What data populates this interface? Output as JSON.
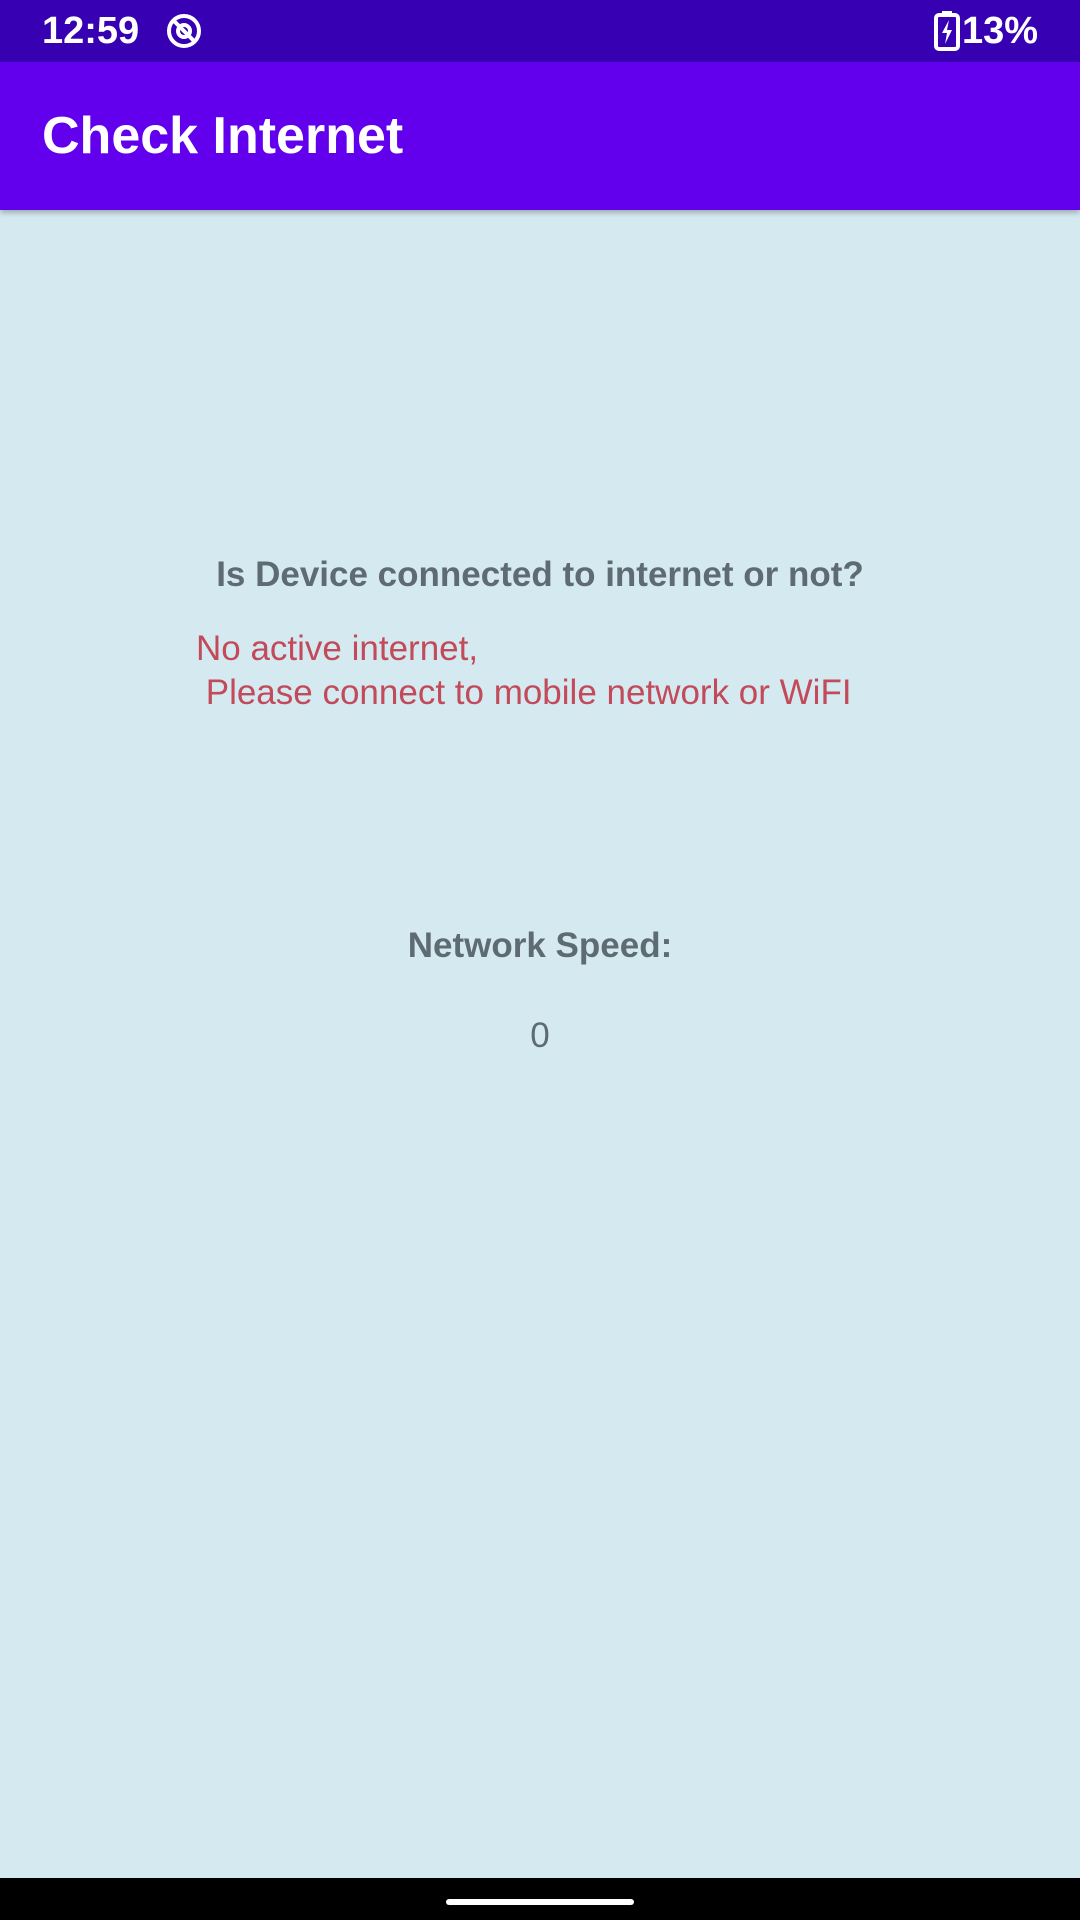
{
  "status_bar": {
    "time": "12:59",
    "battery_percent": "13%",
    "background_color": "#3700b3",
    "app_icon": "at-sign-icon",
    "battery_icon": "battery-charging-icon"
  },
  "app_bar": {
    "title": "Check Internet",
    "background_color": "#6200ee"
  },
  "main": {
    "question": "Is Device connected to internet or not?",
    "status_message": "No active internet,\n Please connect to mobile network or WiFI",
    "status_color": "#c24a5a",
    "speed_label": "Network Speed:",
    "speed_value": "0",
    "background_color": "#d4eaf0"
  }
}
